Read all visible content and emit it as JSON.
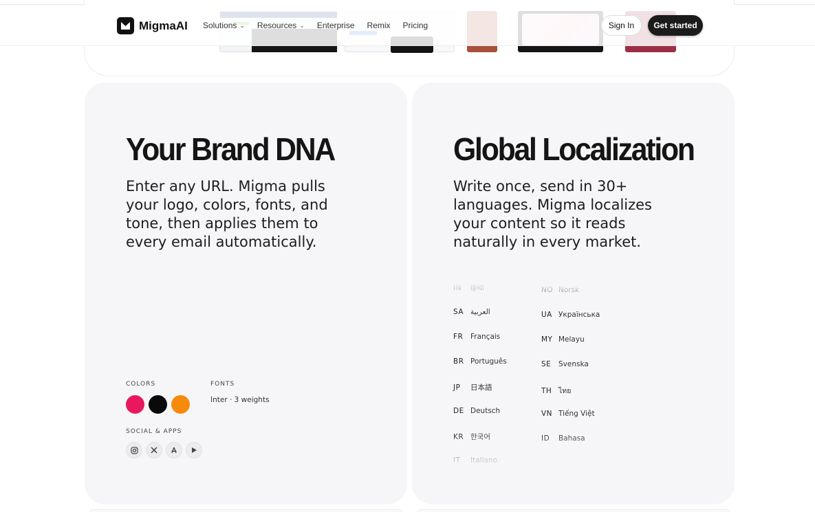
{
  "nav": {
    "brand": "MigmaAI",
    "menu": [
      {
        "label": "Solutions",
        "has_dropdown": true
      },
      {
        "label": "Resources",
        "has_dropdown": true
      },
      {
        "label": "Enterprise",
        "has_dropdown": false
      },
      {
        "label": "Remix",
        "has_dropdown": false
      },
      {
        "label": "Pricing",
        "has_dropdown": false
      }
    ],
    "sign_in": "Sign In",
    "get_started": "Get started"
  },
  "brand_card": {
    "title": "Your Brand DNA",
    "description": "Enter any URL. Migma pulls your logo, colors, fonts, and tone, then applies them to every email automatically.",
    "colors_label": "COLORS",
    "fonts_label": "FONTS",
    "fonts_value": "Inter · 3 weights",
    "colors": [
      "#e8185e",
      "#0a0a0a",
      "#f58a0b"
    ],
    "social_label": "SOCIAL & APPS",
    "socials": [
      "instagram-icon",
      "x-icon",
      "appstore-icon",
      "playstore-icon"
    ]
  },
  "localization_card": {
    "title": "Global Localization",
    "description": "Write once, send in 30+ languages. Migma localizes your content so it reads naturally in every market.",
    "languages_left": [
      {
        "code": "IN",
        "name": "हिन्दी"
      },
      {
        "code": "SA",
        "name": "العربية"
      },
      {
        "code": "FR",
        "name": "Français"
      },
      {
        "code": "BR",
        "name": "Português"
      },
      {
        "code": "JP",
        "name": "日本語"
      },
      {
        "code": "DE",
        "name": "Deutsch"
      },
      {
        "code": "KR",
        "name": "한국어"
      },
      {
        "code": "IT",
        "name": "Italiano"
      }
    ],
    "languages_right": [
      {
        "code": "NO",
        "name": "Norsk"
      },
      {
        "code": "UA",
        "name": "Українська"
      },
      {
        "code": "MY",
        "name": "Melayu"
      },
      {
        "code": "SE",
        "name": "Svenska"
      },
      {
        "code": "TH",
        "name": "ไทย"
      },
      {
        "code": "VN",
        "name": "Tiếng Việt"
      },
      {
        "code": "ID",
        "name": "Bahasa"
      },
      {
        "code": "",
        "name": ""
      }
    ]
  }
}
